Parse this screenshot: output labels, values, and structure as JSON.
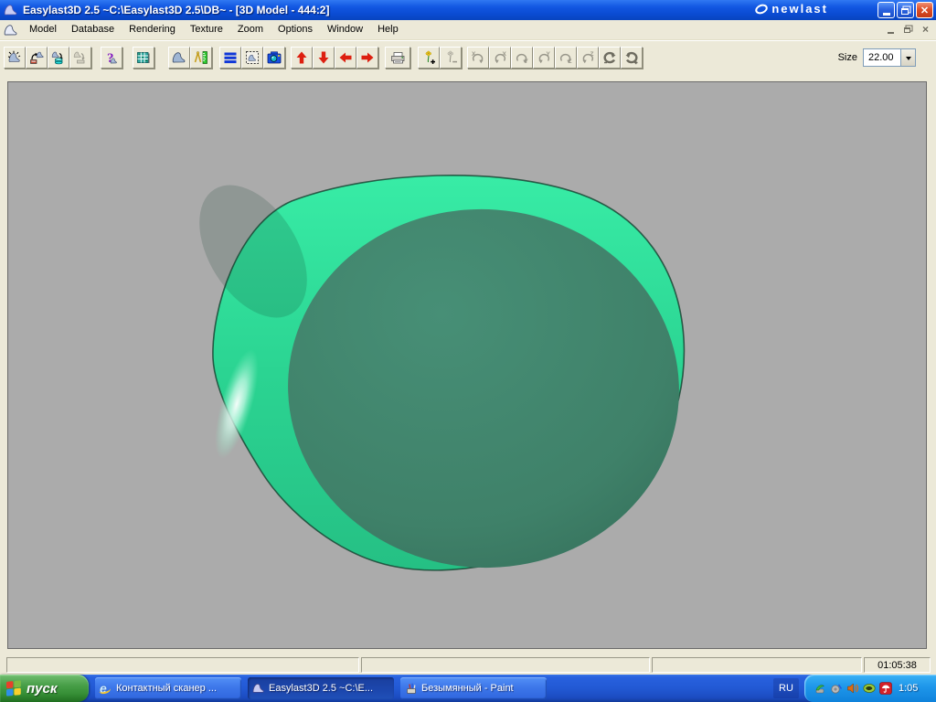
{
  "window": {
    "title": "Easylast3D 2.5 ~C:\\Easylast3D 2.5\\DB~ - [3D Model - 444:2]",
    "brand_logo": "newlast"
  },
  "menubar": {
    "items": [
      "Model",
      "Database",
      "Rendering",
      "Texture",
      "Zoom",
      "Options",
      "Window",
      "Help"
    ]
  },
  "toolbar": {
    "size_label": "Size",
    "size_value": "22.00",
    "icons": [
      "new-last-icon",
      "open-last-icon",
      "save-last-to-db-icon",
      "save-last-icon-disabled",
      "help-question-icon",
      "database-table-icon",
      "last-view-icon",
      "compass-ruler-icon",
      "sections-icon",
      "copy-view-icon",
      "camera-snapshot-icon",
      "arrow-up-icon",
      "arrow-down-icon",
      "arrow-left-icon",
      "arrow-right-icon",
      "printer-icon",
      "add-point-icon",
      "delete-point-icon-disabled",
      "rotate-x-ccw-icon-disabled",
      "rotate-x-cw-icon-disabled",
      "rotate-y-ccw-icon-disabled",
      "rotate-y-cw-icon-disabled",
      "rotate-z-ccw-icon-disabled",
      "rotate-z-cw-icon-disabled",
      "rotate-ccw-minus-icon-disabled",
      "rotate-cw-plus-icon-disabled"
    ]
  },
  "viewport": {
    "model": "3d-shoe-last-heel-view",
    "rim_color": "#2FDF9C",
    "face_color": "#3F8A70",
    "background_color": "#ABABAB"
  },
  "statusbar": {
    "time": "01:05:38"
  },
  "taskbar": {
    "start_label": "пуск",
    "buttons": [
      {
        "label": "Контактный сканер ...",
        "icon": "internet-explorer-icon",
        "active": false
      },
      {
        "label": "Easylast3D 2.5 ~C:\\E...",
        "icon": "shoe-last-icon",
        "active": true
      },
      {
        "label": "Безымянный - Paint",
        "icon": "paint-icon",
        "active": false
      }
    ],
    "language_indicator": "RU",
    "tray_icons": [
      "device-icon",
      "audio-settings-icon",
      "volume-icon",
      "nvidia-icon",
      "avira-umbrella-icon"
    ],
    "clock": "1:05"
  }
}
